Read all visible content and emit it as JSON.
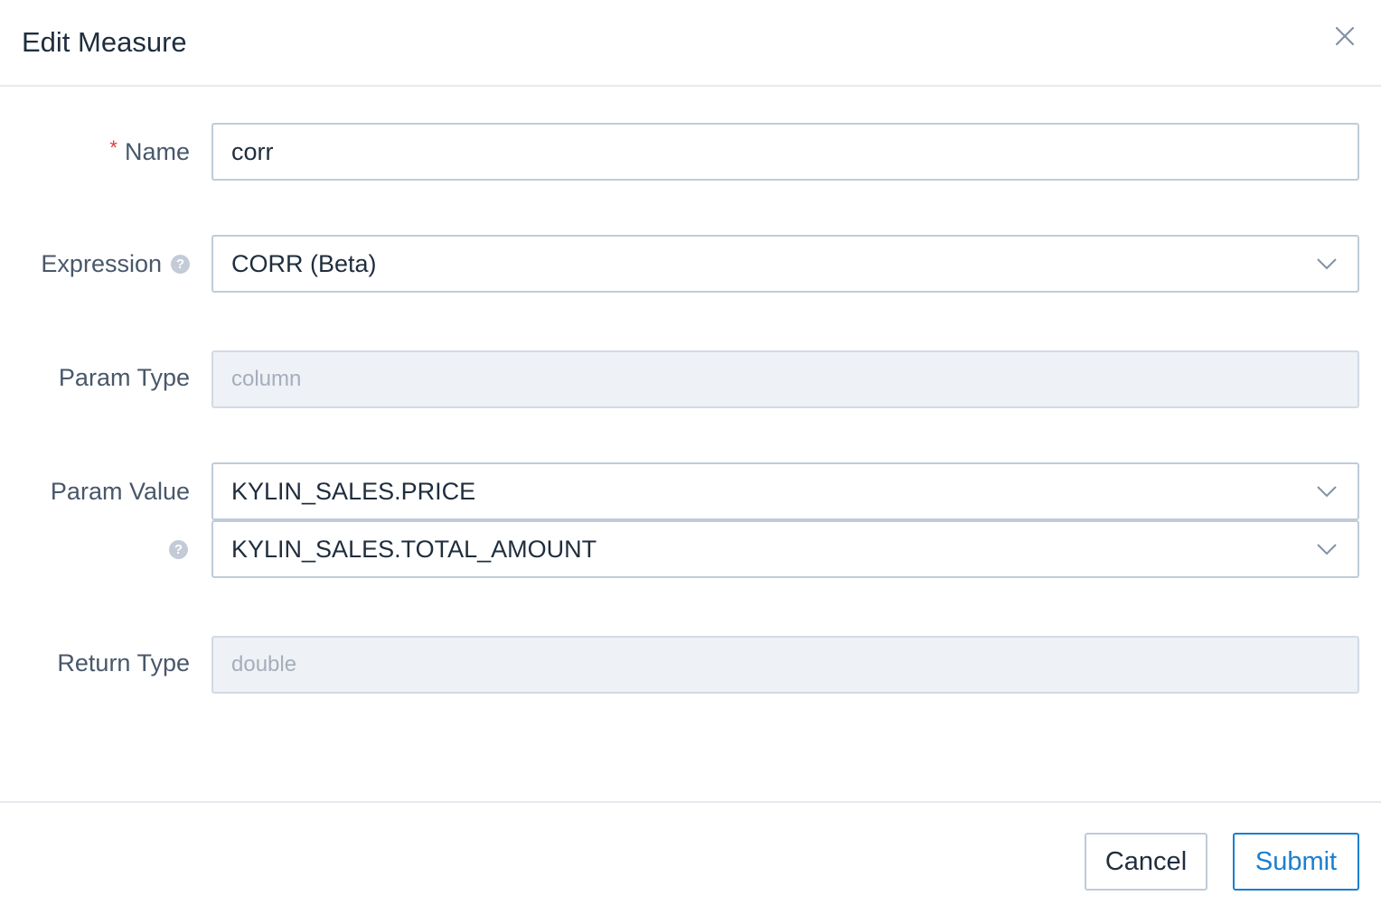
{
  "dialog": {
    "title": "Edit Measure",
    "close_icon": "close-icon"
  },
  "form": {
    "name": {
      "label": "Name",
      "required_mark": "*",
      "value": "corr"
    },
    "expression": {
      "label": "Expression",
      "help_icon": "question-circle-icon",
      "selected": "CORR (Beta)"
    },
    "param_type": {
      "label": "Param Type",
      "value": "column"
    },
    "param_value": {
      "label": "Param Value",
      "help_icon": "question-circle-icon",
      "values": [
        "KYLIN_SALES.PRICE",
        "KYLIN_SALES.TOTAL_AMOUNT"
      ]
    },
    "return_type": {
      "label": "Return Type",
      "value": "double"
    }
  },
  "footer": {
    "cancel_label": "Cancel",
    "submit_label": "Submit"
  },
  "colors": {
    "required": "#e0383e",
    "primary": "#1a7fd0",
    "border": "#bfcbd9",
    "disabled_bg": "#eef1f6"
  }
}
